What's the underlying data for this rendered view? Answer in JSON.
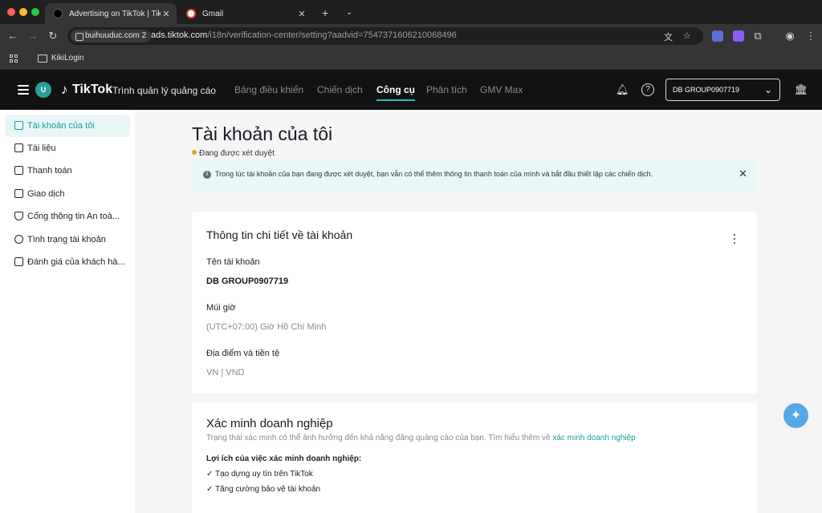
{
  "browser": {
    "tabs": [
      {
        "title": "Advertising on TikTok | TikTok",
        "active": true
      },
      {
        "title": "Gmail",
        "active": false
      }
    ],
    "site_chip": "buihuuduc.com 2",
    "url_host": "ads.tiktok.com",
    "url_path": "/i18n/verification-center/setting?aadvid=7547371606210068496",
    "bookmark": "KikiLogin"
  },
  "header": {
    "avatar_initial": "U",
    "brand": "TikTok",
    "subtitle": "Trình quản lý quảng cáo",
    "nav": [
      {
        "label": "Bảng điều khiển",
        "active": false
      },
      {
        "label": "Chiến dịch",
        "active": false
      },
      {
        "label": "Công cụ",
        "active": true
      },
      {
        "label": "Phân tích",
        "active": false
      },
      {
        "label": "GMV Max",
        "active": false
      }
    ],
    "account_selector": "DB GROUP0907719"
  },
  "sidebar": {
    "items": [
      {
        "label": "Tài khoản của tôi",
        "icon": "id-card-icon",
        "active": true
      },
      {
        "label": "Tài liệu",
        "icon": "document-icon",
        "active": false
      },
      {
        "label": "Thanh toán",
        "icon": "wallet-icon",
        "active": false
      },
      {
        "label": "Giao dịch",
        "icon": "receipt-icon",
        "active": false
      },
      {
        "label": "Cổng thông tin An toà...",
        "icon": "shield-icon",
        "active": false
      },
      {
        "label": "Tình trạng tài khoản",
        "icon": "stethoscope-icon",
        "active": false
      },
      {
        "label": "Đánh giá của khách hà...",
        "icon": "feedback-icon",
        "active": false
      }
    ]
  },
  "main": {
    "title": "Tài khoản của tôi",
    "status": "Đang được xét duyệt",
    "status_color": "#e0a21b",
    "banner": "Trong lúc tài khoản của bạn đang được xét duyệt, bạn vẫn có thể thêm thông tin thanh toán của mình và bắt đầu thiết lập các chiến dịch.",
    "details": {
      "title": "Thông tin chi tiết về tài khoản",
      "fields": [
        {
          "label": "Tên tài khoản",
          "value": "DB GROUP0907719"
        },
        {
          "label": "Múi giờ",
          "value": "(UTC+07:00) Giờ Hồ Chí Minh"
        },
        {
          "label": "Địa điểm và tiền tệ",
          "value": "VN | VND"
        }
      ]
    },
    "business": {
      "title": "Xác minh doanh nghiệp",
      "desc": "Trạng thái xác minh có thể ảnh hưởng đến khả năng đăng quảng cáo của bạn. Tìm hiểu thêm về ",
      "desc_link": "xác minh doanh nghiệp",
      "benefits_title": "Lợi ích của việc xác minh doanh nghiệp:",
      "benefits": [
        "✓ Tạo dựng uy tín trên TikTok",
        "✓ Tăng cường bảo vệ tài khoản"
      ]
    }
  },
  "colors": {
    "accent": "#25c2c2",
    "header_bg": "#121212"
  }
}
